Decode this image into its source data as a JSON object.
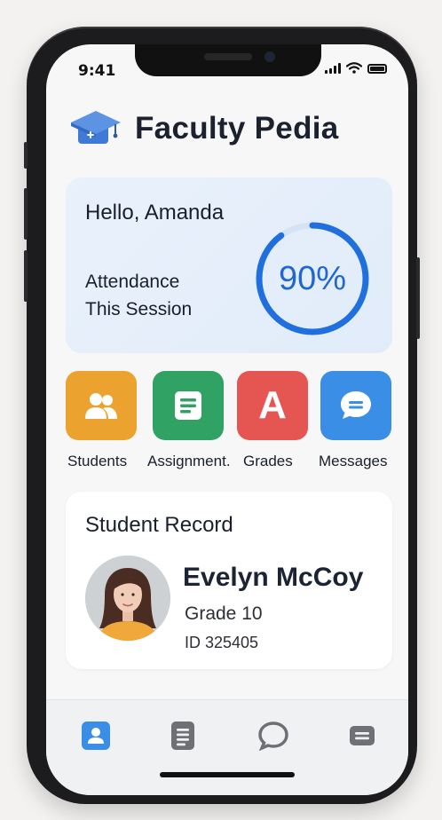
{
  "status_bar": {
    "time": "9:41"
  },
  "app": {
    "title": "Faculty Pedia",
    "logo_icon": "graduation-cap-icon"
  },
  "greeting": {
    "text": "Hello, Amanda",
    "attendance_label_line1": "Attendance",
    "attendance_label_line2": "This Session",
    "attendance_value": "90%",
    "attendance_fraction": 0.9,
    "ring_color": "#1f6fde"
  },
  "quick_actions": [
    {
      "label": "Students",
      "icon": "people-icon",
      "color": "#eba22e"
    },
    {
      "label": "Assignment.",
      "icon": "document-icon",
      "color": "#2fa264"
    },
    {
      "label": "Grades",
      "icon": "letter-a-icon",
      "color": "#e55552"
    },
    {
      "label": "Messages",
      "icon": "chat-bubble-icon",
      "color": "#3b8ee6"
    }
  ],
  "student_record": {
    "title": "Student Record",
    "name": "Evelyn McCoy",
    "grade": "Grade 10",
    "id": "ID 325405"
  },
  "tab_bar": [
    {
      "icon": "profile-icon",
      "active": true
    },
    {
      "icon": "document-icon",
      "active": false
    },
    {
      "icon": "chat-icon",
      "active": false
    },
    {
      "icon": "menu-icon",
      "active": false
    }
  ],
  "colors": {
    "accent": "#3b8ee6",
    "title_text": "#1c2130",
    "card_bg": "#e5eefa"
  }
}
